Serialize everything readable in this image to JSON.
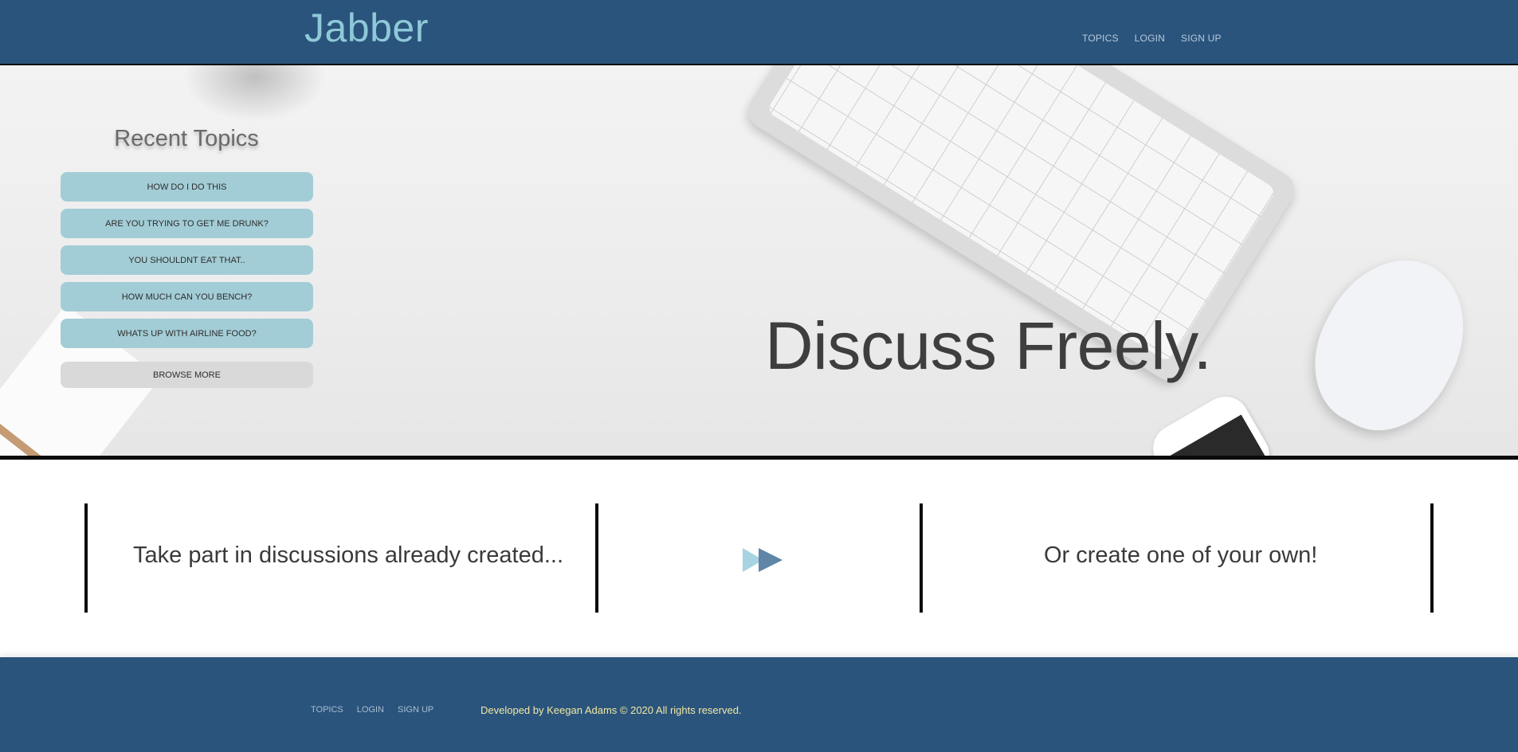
{
  "header": {
    "brand": "Jabber",
    "nav": [
      "TOPICS",
      "LOGIN",
      "SIGN UP"
    ]
  },
  "hero": {
    "headline": "Discuss Freely.",
    "recent_topics_title": "Recent Topics",
    "topics": [
      "HOW DO I DO THIS",
      "ARE YOU TRYING TO GET ME DRUNK?",
      "YOU SHOULDNT EAT THAT..",
      "HOW MUCH CAN YOU BENCH?",
      "WHATS UP WITH AIRLINE FOOD?"
    ],
    "browse_more": "BROWSE MORE"
  },
  "middle": {
    "left_text": "Take part in discussions already created...",
    "right_text": "Or create one of your own!"
  },
  "footer": {
    "nav": [
      "TOPICS",
      "LOGIN",
      "SIGN UP"
    ],
    "copyright": "Developed by Keegan Adams © 2020 All rights reserved."
  },
  "colors": {
    "header_bg": "#2a547c",
    "brand": "#8fc9d9",
    "topic_button": "#a3cdd6",
    "copyright_text": "#f3e8a4"
  },
  "icons": {
    "middle_arrows": "double-play-arrow-icon"
  }
}
